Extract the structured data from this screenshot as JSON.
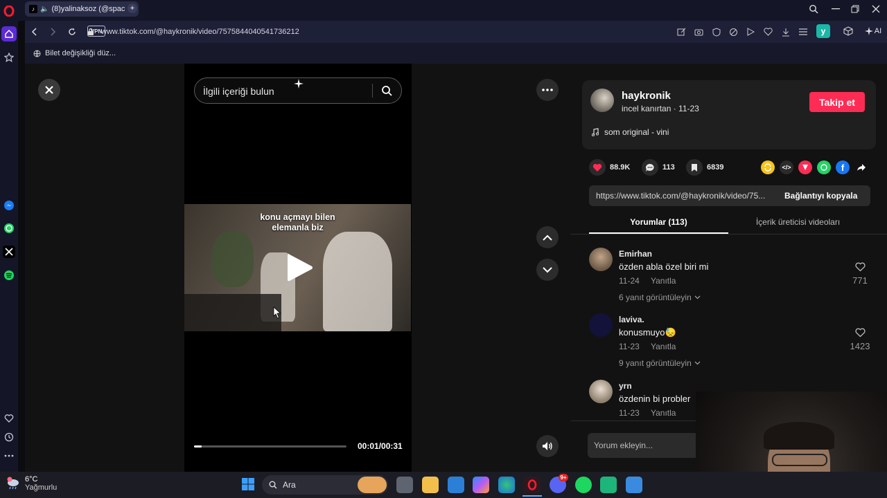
{
  "browser": {
    "tab_title": "(8)yalinaksoz (@spac",
    "url": "www.tiktok.com/@haykronik/video/7575844040541736212",
    "vpn_label": "VPN",
    "ai_label": "AI",
    "profile_initial": "y",
    "bookmark_label": "Bilet değişikliği düz..."
  },
  "video": {
    "search_placeholder": "İlgili içeriği bulun",
    "caption_line1": "konu açmayı bilen",
    "caption_line2": "elemanla biz",
    "time": "00:01/00:31",
    "progress": 0.05
  },
  "creator": {
    "username": "haykronik",
    "nickname_date": "incel kanırtan · 11-23",
    "follow_label": "Takip et",
    "sound": "som original - vini"
  },
  "stats": {
    "likes": "88.9K",
    "comments": "113",
    "saves": "6839"
  },
  "share": {
    "link": "https://www.tiktok.com/@haykronik/video/75...",
    "copy_label": "Bağlantıyı kopyala"
  },
  "tabs": {
    "comments": "Yorumlar (113)",
    "creator_videos": "İçerik üreticisi videoları"
  },
  "comments": [
    {
      "name": "Emirhan",
      "text": "özden abla özel biri mi",
      "date": "11-24",
      "reply": "Yanıtla",
      "likes": "771",
      "view_replies": "6 yanıt görüntüleyin"
    },
    {
      "name": "laviva.",
      "text": "konusmuyo😓",
      "date": "11-23",
      "reply": "Yanıtla",
      "likes": "1423",
      "view_replies": "9 yanıt görüntüleyin"
    },
    {
      "name": "yrn",
      "text": "özdenin bi probler",
      "date": "11-23",
      "reply": "Yanıtla"
    }
  ],
  "comment_input_placeholder": "Yorum ekleyin...",
  "taskbar": {
    "temperature": "6°C",
    "weather": "Yağmurlu",
    "search_label": "Ara",
    "discord_badge": "9+"
  },
  "colors": {
    "accent": "#fe2c55",
    "opera_red": "#ff1b2d"
  }
}
